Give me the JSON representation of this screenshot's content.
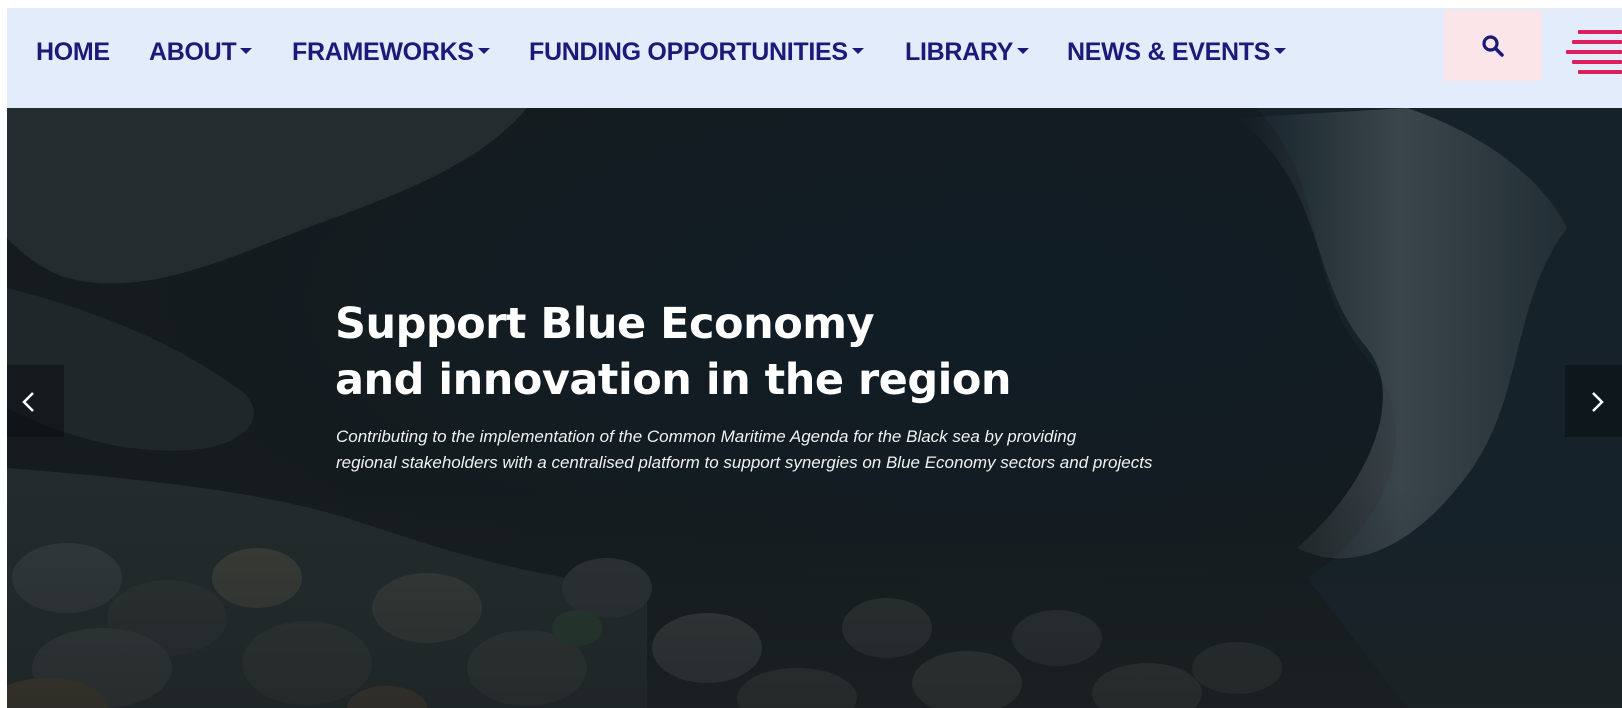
{
  "nav": {
    "items": [
      {
        "label": "HOME",
        "has_dropdown": false
      },
      {
        "label": "ABOUT",
        "has_dropdown": true
      },
      {
        "label": "FRAMEWORKS",
        "has_dropdown": true
      },
      {
        "label": "FUNDING OPPORTUNITIES",
        "has_dropdown": true
      },
      {
        "label": "LIBRARY",
        "has_dropdown": true
      },
      {
        "label": "NEWS & EVENTS",
        "has_dropdown": true
      }
    ],
    "search_icon": "search-icon",
    "menu_icon": "hamburger-menu-icon"
  },
  "hero": {
    "title_line1": "Support Blue Economy",
    "title_line2": "and innovation in the region",
    "subtitle_line1": "Contributing to the implementation of the Common Maritime Agenda for the Black sea by providing",
    "subtitle_line2": "regional stakeholders with a centralised platform to support synergies on Blue Economy sectors and projects",
    "prev_icon": "chevron-left-icon",
    "next_icon": "chevron-right-icon"
  },
  "colors": {
    "nav_background": "#e3ecfb",
    "nav_text": "#1c1a78",
    "search_background": "#fbe5e9",
    "menu_accent": "#de1f5e",
    "hero_text": "#ffffff"
  }
}
